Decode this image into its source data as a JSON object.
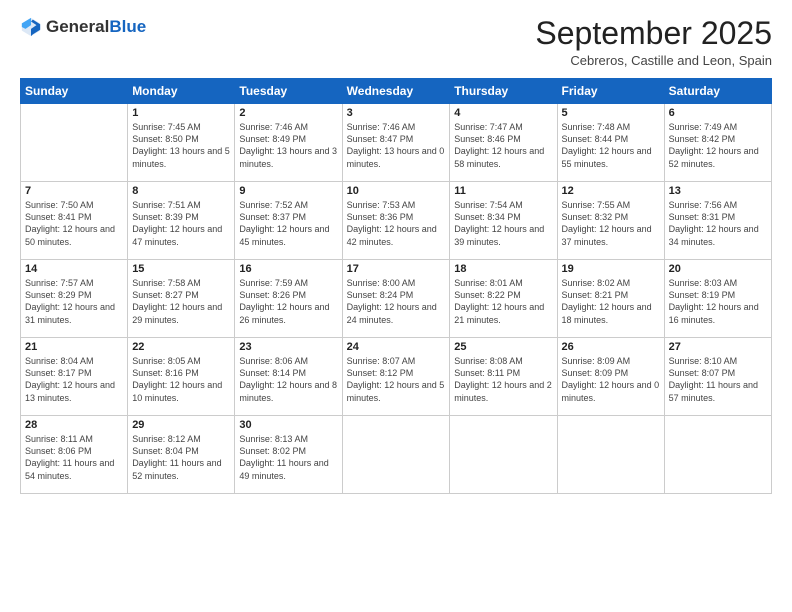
{
  "logo": {
    "general": "General",
    "blue": "Blue"
  },
  "header": {
    "month_title": "September 2025",
    "location": "Cebreros, Castille and Leon, Spain"
  },
  "days_of_week": [
    "Sunday",
    "Monday",
    "Tuesday",
    "Wednesday",
    "Thursday",
    "Friday",
    "Saturday"
  ],
  "weeks": [
    [
      {
        "day": "",
        "sunrise": "",
        "sunset": "",
        "daylight": ""
      },
      {
        "day": "1",
        "sunrise": "Sunrise: 7:45 AM",
        "sunset": "Sunset: 8:50 PM",
        "daylight": "Daylight: 13 hours and 5 minutes."
      },
      {
        "day": "2",
        "sunrise": "Sunrise: 7:46 AM",
        "sunset": "Sunset: 8:49 PM",
        "daylight": "Daylight: 13 hours and 3 minutes."
      },
      {
        "day": "3",
        "sunrise": "Sunrise: 7:46 AM",
        "sunset": "Sunset: 8:47 PM",
        "daylight": "Daylight: 13 hours and 0 minutes."
      },
      {
        "day": "4",
        "sunrise": "Sunrise: 7:47 AM",
        "sunset": "Sunset: 8:46 PM",
        "daylight": "Daylight: 12 hours and 58 minutes."
      },
      {
        "day": "5",
        "sunrise": "Sunrise: 7:48 AM",
        "sunset": "Sunset: 8:44 PM",
        "daylight": "Daylight: 12 hours and 55 minutes."
      },
      {
        "day": "6",
        "sunrise": "Sunrise: 7:49 AM",
        "sunset": "Sunset: 8:42 PM",
        "daylight": "Daylight: 12 hours and 52 minutes."
      }
    ],
    [
      {
        "day": "7",
        "sunrise": "Sunrise: 7:50 AM",
        "sunset": "Sunset: 8:41 PM",
        "daylight": "Daylight: 12 hours and 50 minutes."
      },
      {
        "day": "8",
        "sunrise": "Sunrise: 7:51 AM",
        "sunset": "Sunset: 8:39 PM",
        "daylight": "Daylight: 12 hours and 47 minutes."
      },
      {
        "day": "9",
        "sunrise": "Sunrise: 7:52 AM",
        "sunset": "Sunset: 8:37 PM",
        "daylight": "Daylight: 12 hours and 45 minutes."
      },
      {
        "day": "10",
        "sunrise": "Sunrise: 7:53 AM",
        "sunset": "Sunset: 8:36 PM",
        "daylight": "Daylight: 12 hours and 42 minutes."
      },
      {
        "day": "11",
        "sunrise": "Sunrise: 7:54 AM",
        "sunset": "Sunset: 8:34 PM",
        "daylight": "Daylight: 12 hours and 39 minutes."
      },
      {
        "day": "12",
        "sunrise": "Sunrise: 7:55 AM",
        "sunset": "Sunset: 8:32 PM",
        "daylight": "Daylight: 12 hours and 37 minutes."
      },
      {
        "day": "13",
        "sunrise": "Sunrise: 7:56 AM",
        "sunset": "Sunset: 8:31 PM",
        "daylight": "Daylight: 12 hours and 34 minutes."
      }
    ],
    [
      {
        "day": "14",
        "sunrise": "Sunrise: 7:57 AM",
        "sunset": "Sunset: 8:29 PM",
        "daylight": "Daylight: 12 hours and 31 minutes."
      },
      {
        "day": "15",
        "sunrise": "Sunrise: 7:58 AM",
        "sunset": "Sunset: 8:27 PM",
        "daylight": "Daylight: 12 hours and 29 minutes."
      },
      {
        "day": "16",
        "sunrise": "Sunrise: 7:59 AM",
        "sunset": "Sunset: 8:26 PM",
        "daylight": "Daylight: 12 hours and 26 minutes."
      },
      {
        "day": "17",
        "sunrise": "Sunrise: 8:00 AM",
        "sunset": "Sunset: 8:24 PM",
        "daylight": "Daylight: 12 hours and 24 minutes."
      },
      {
        "day": "18",
        "sunrise": "Sunrise: 8:01 AM",
        "sunset": "Sunset: 8:22 PM",
        "daylight": "Daylight: 12 hours and 21 minutes."
      },
      {
        "day": "19",
        "sunrise": "Sunrise: 8:02 AM",
        "sunset": "Sunset: 8:21 PM",
        "daylight": "Daylight: 12 hours and 18 minutes."
      },
      {
        "day": "20",
        "sunrise": "Sunrise: 8:03 AM",
        "sunset": "Sunset: 8:19 PM",
        "daylight": "Daylight: 12 hours and 16 minutes."
      }
    ],
    [
      {
        "day": "21",
        "sunrise": "Sunrise: 8:04 AM",
        "sunset": "Sunset: 8:17 PM",
        "daylight": "Daylight: 12 hours and 13 minutes."
      },
      {
        "day": "22",
        "sunrise": "Sunrise: 8:05 AM",
        "sunset": "Sunset: 8:16 PM",
        "daylight": "Daylight: 12 hours and 10 minutes."
      },
      {
        "day": "23",
        "sunrise": "Sunrise: 8:06 AM",
        "sunset": "Sunset: 8:14 PM",
        "daylight": "Daylight: 12 hours and 8 minutes."
      },
      {
        "day": "24",
        "sunrise": "Sunrise: 8:07 AM",
        "sunset": "Sunset: 8:12 PM",
        "daylight": "Daylight: 12 hours and 5 minutes."
      },
      {
        "day": "25",
        "sunrise": "Sunrise: 8:08 AM",
        "sunset": "Sunset: 8:11 PM",
        "daylight": "Daylight: 12 hours and 2 minutes."
      },
      {
        "day": "26",
        "sunrise": "Sunrise: 8:09 AM",
        "sunset": "Sunset: 8:09 PM",
        "daylight": "Daylight: 12 hours and 0 minutes."
      },
      {
        "day": "27",
        "sunrise": "Sunrise: 8:10 AM",
        "sunset": "Sunset: 8:07 PM",
        "daylight": "Daylight: 11 hours and 57 minutes."
      }
    ],
    [
      {
        "day": "28",
        "sunrise": "Sunrise: 8:11 AM",
        "sunset": "Sunset: 8:06 PM",
        "daylight": "Daylight: 11 hours and 54 minutes."
      },
      {
        "day": "29",
        "sunrise": "Sunrise: 8:12 AM",
        "sunset": "Sunset: 8:04 PM",
        "daylight": "Daylight: 11 hours and 52 minutes."
      },
      {
        "day": "30",
        "sunrise": "Sunrise: 8:13 AM",
        "sunset": "Sunset: 8:02 PM",
        "daylight": "Daylight: 11 hours and 49 minutes."
      },
      {
        "day": "",
        "sunrise": "",
        "sunset": "",
        "daylight": ""
      },
      {
        "day": "",
        "sunrise": "",
        "sunset": "",
        "daylight": ""
      },
      {
        "day": "",
        "sunrise": "",
        "sunset": "",
        "daylight": ""
      },
      {
        "day": "",
        "sunrise": "",
        "sunset": "",
        "daylight": ""
      }
    ]
  ]
}
